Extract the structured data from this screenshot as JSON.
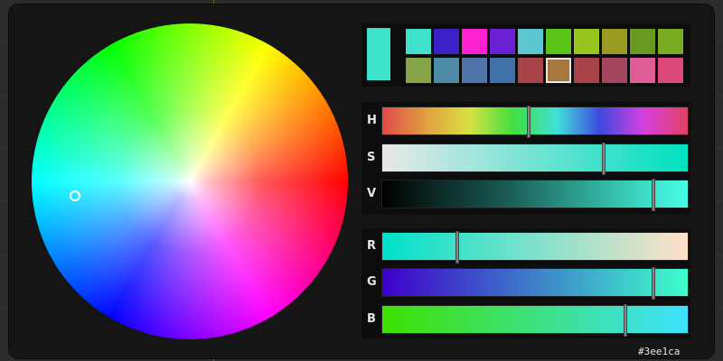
{
  "color_picker": {
    "hex": "#3ee1ca",
    "current_color": "#3ee1ca",
    "wheel": {
      "marker_icon": "selector-circle-icon"
    },
    "swatches": [
      "#3ee1ca",
      "#3e21c9",
      "#ff21cf",
      "#6a21d4",
      "#5bc8cf",
      "#5bc51a",
      "#97c61e",
      "#9a9a21",
      "#6a9a21",
      "#7aac21",
      "#86a446",
      "#4c8aa8",
      "#4f74a8",
      "#4070a8",
      "#a8434a",
      "#a8793f",
      "#a8434a",
      "#a6465e",
      "#e05c97",
      "#dc4978"
    ],
    "selected_swatch_index": 15,
    "hsv": [
      {
        "label": "H",
        "value": 0.476
      },
      {
        "label": "S",
        "value": 0.72
      },
      {
        "label": "V",
        "value": 0.883
      }
    ],
    "rgb": [
      {
        "label": "R",
        "value": 62
      },
      {
        "label": "G",
        "value": 225
      },
      {
        "label": "B",
        "value": 202
      }
    ]
  }
}
